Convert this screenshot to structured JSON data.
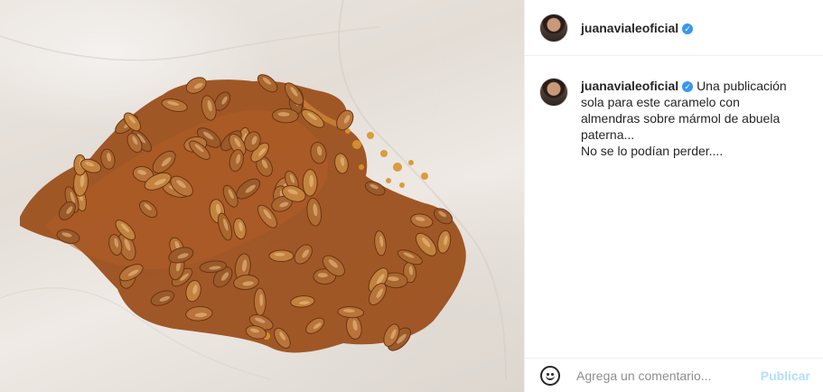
{
  "post": {
    "photo_alt": "caramelo con almendras",
    "header": {
      "username": "juanavialeoficial",
      "verified": true
    },
    "caption": {
      "username": "juanavialeoficial",
      "text_line1": "Una publicación sola para este caramelo con almendras sobre mármol de abuela paterna...",
      "text_line2": "No se lo podían perder...."
    },
    "comment_box": {
      "placeholder": "Agrega un comentario...",
      "publish_label": "Publicar"
    }
  },
  "colors": {
    "accent": "#3897f0",
    "publish_disabled": "#b2dffc",
    "caramel": "#a0531f",
    "almond": "#b8743a"
  },
  "icons": {
    "verified": "verified-badge-icon",
    "emoji": "emoji-smile-icon"
  }
}
